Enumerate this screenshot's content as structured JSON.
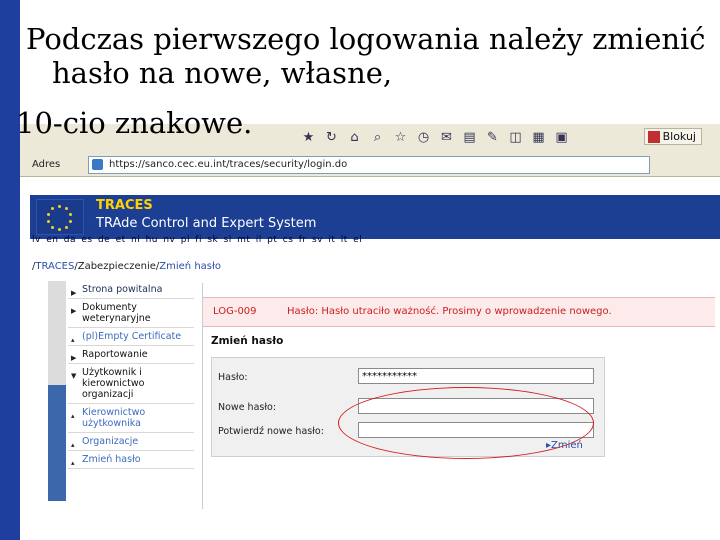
{
  "caption": {
    "line1": "Podczas pierwszego logowania należy zmienić",
    "line2": "hasło na nowe, własne,",
    "line3": "10-cio znakowe."
  },
  "browser": {
    "blokuj_label": "Blokuj",
    "address_label": "Adres",
    "address_url": "https://sanco.cec.eu.int/traces/security/login.do",
    "icons": [
      "star-icon",
      "refresh-icon",
      "home-icon",
      "search-icon",
      "favorites-icon",
      "history-icon",
      "mail-icon",
      "print-icon",
      "edit-icon",
      "discuss-icon",
      "media-icon",
      "popup-block-icon"
    ]
  },
  "banner": {
    "title": "TRACES",
    "subtitle": "TRAde Control and Expert System"
  },
  "languages": "lv  en  da  es  de  et  nl  hu  nv  pl  fi  sk  sl  mt  il  pt  cs  fr  sv  it  lt  el",
  "breadcrumb": {
    "part1": "TRACES",
    "part2": "Zabezpieczenie",
    "part3": "Zmień hasło"
  },
  "menu": [
    {
      "label": "Strona powitalna"
    },
    {
      "label": "Dokumenty weterynaryjne"
    },
    {
      "label": "(pl)Empty Certificate"
    },
    {
      "label": "Raportowanie"
    },
    {
      "label": "Użytkownik i kierownictwo organizacji"
    },
    {
      "label": "Kierownictwo użytkownika"
    },
    {
      "label": "Organizacje"
    },
    {
      "label": "Zmień hasło"
    }
  ],
  "error": {
    "code": "LOG-009",
    "message": "Hasło: Hasło utraciło ważność. Prosimy o wprowadzenie nowego."
  },
  "form": {
    "title": "Zmień hasło",
    "password_label": "Hasło:",
    "password_value": "***********",
    "new_password_label": "Nowe hasło:",
    "confirm_label": "Potwierdź nowe hasło:",
    "submit_label": "Zmień"
  },
  "colors": {
    "slide_bar": "#1f3f9f",
    "banner": "#1c3f94",
    "error_text": "#cc2020",
    "highlight_ellipse": "#d22020"
  }
}
